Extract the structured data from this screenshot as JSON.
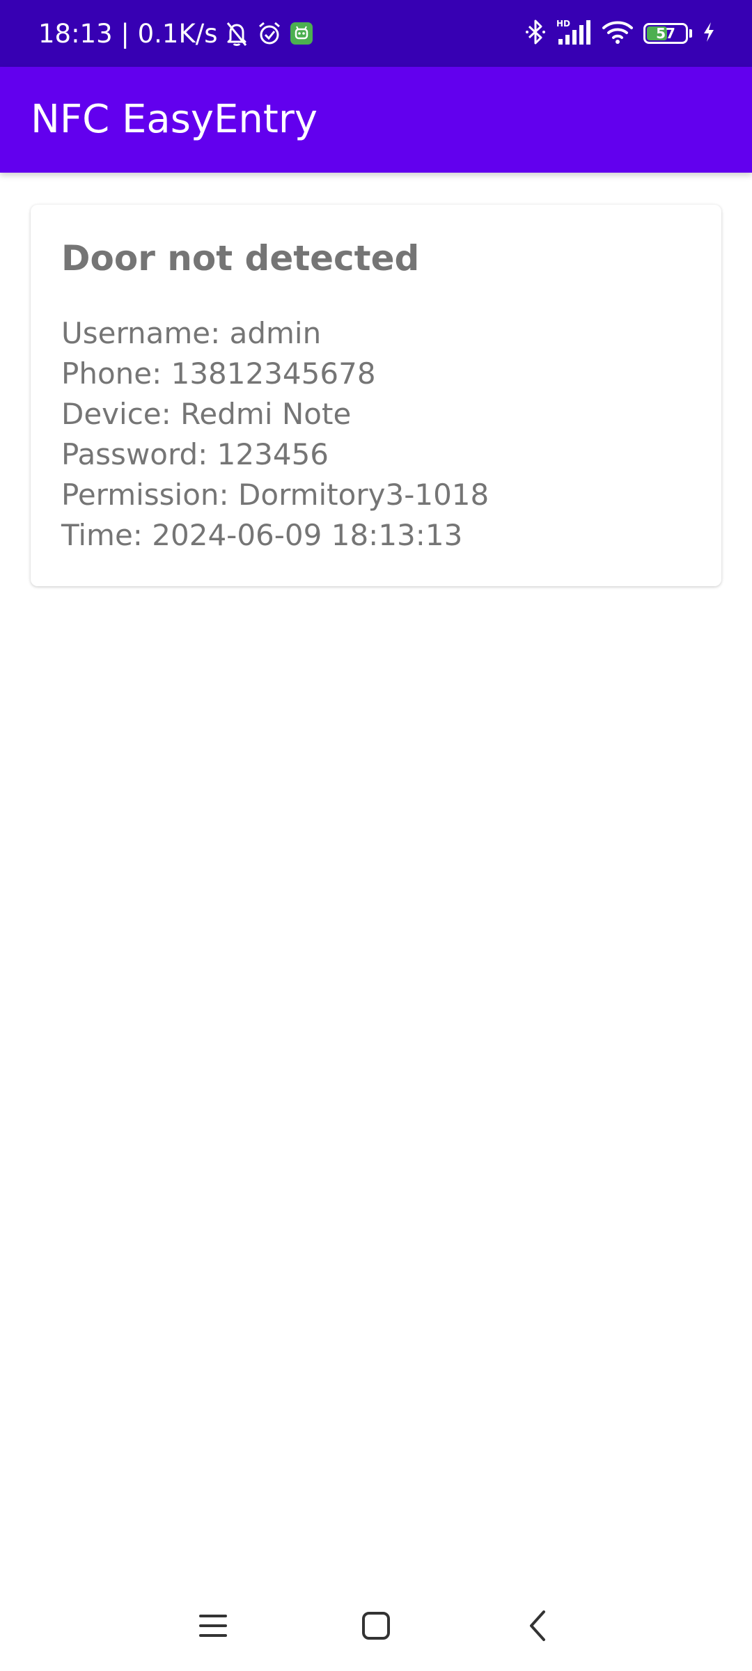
{
  "status_bar": {
    "time_speed": "18:13 | 0.1K/s",
    "battery_level": "57",
    "signal_label": "HD",
    "icons": [
      "mute-icon",
      "alarm-icon",
      "app-notification-icon",
      "bluetooth-icon",
      "signal-icon",
      "wifi-icon",
      "battery-icon",
      "charging-icon"
    ]
  },
  "app_bar": {
    "title": "NFC EasyEntry"
  },
  "card": {
    "title": "Door not detected",
    "lines": [
      "Username: admin",
      "Phone: 13812345678",
      "Device: Redmi Note",
      "Password: 123456",
      "Permission: Dormitory3-1018",
      "Time: 2024-06-09 18:13:13"
    ]
  },
  "nav_bar": {
    "icons": [
      "menu-icon",
      "home-icon",
      "back-icon"
    ]
  },
  "colors": {
    "status_bar": "#3700b3",
    "primary": "#6200ee",
    "card_text": "#757575",
    "battery_fill": "#4caf50"
  }
}
